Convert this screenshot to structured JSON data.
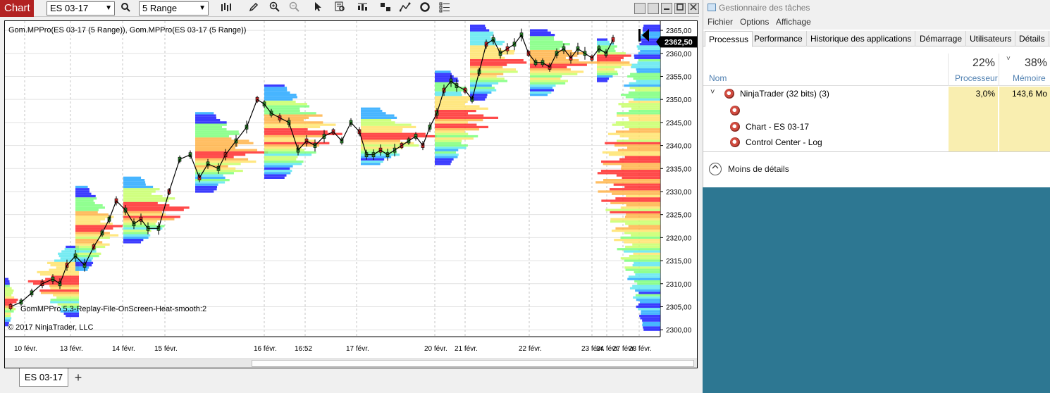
{
  "chart_window": {
    "badge": "Chart",
    "instrument": "ES 03-17",
    "bar_type": "5 Range",
    "indicator_label": "Gom.MPPro(ES 03-17 (5 Range)), Gom.MPPro(ES 03-17 (5 Range))",
    "template_label": "GomMPPro 5.3-Replay-File-OnScreen-Heat-smooth:2",
    "copyright": "© 2017 NinjaTrader, LLC",
    "tab_label": "ES 03-17",
    "add_tab": "+",
    "icons": [
      "search-icon",
      "bar-style-icon",
      "draw-pencil-icon",
      "zoom-in-icon",
      "zoom-out-icon",
      "pointer-icon",
      "data-box-icon",
      "bar-spacing-icon",
      "template-icon",
      "strategy-icon",
      "refresh-icon",
      "properties-icon"
    ]
  },
  "chart_data": {
    "type": "line",
    "instrument": "ES 03-17",
    "y_labels": [
      "2365,00",
      "2360,00",
      "2355,00",
      "2350,00",
      "2345,00",
      "2340,00",
      "2335,00",
      "2330,00",
      "2325,00",
      "2320,00",
      "2315,00",
      "2310,00",
      "2305,00",
      "2300,00"
    ],
    "y_values": [
      2365,
      2360,
      2355,
      2350,
      2345,
      2340,
      2335,
      2330,
      2325,
      2320,
      2315,
      2310,
      2305,
      2300
    ],
    "ylim": [
      2298.5,
      2367
    ],
    "last_price": "2362,50",
    "last_price_value": 2362.5,
    "x_labels": [
      "10 févr.",
      "13 févr.",
      "14 févr.",
      "15 févr.",
      "16 févr.",
      "16:52",
      "17 févr.",
      "20 févr.",
      "21 févr.",
      "22 févr.",
      "23 févr.",
      "24 févr.",
      "27 févr.",
      "28 févr."
    ],
    "series": [
      {
        "x": [
          0,
          15,
          30,
          45,
          60,
          70,
          80,
          92,
          105,
          118,
          130,
          140,
          150,
          163,
          175,
          185,
          195,
          210,
          225,
          240,
          255,
          268,
          280,
          295,
          305,
          320,
          335,
          350,
          360,
          370,
          382,
          395,
          408,
          420,
          432,
          445,
          458,
          470,
          483,
          495,
          505,
          515,
          525,
          535,
          545,
          555,
          565,
          575,
          585,
          595,
          605,
          615,
          625,
          633,
          645,
          655,
          665,
          675,
          685,
          695,
          705,
          715,
          725,
          735,
          745,
          755,
          765,
          775,
          785,
          795,
          805,
          815,
          825,
          835,
          845,
          855
        ],
        "close": [
          2305,
          2306,
          2308,
          2310,
          2311,
          2310,
          2314,
          2316,
          2314,
          2318,
          2321,
          2324,
          2328,
          2326,
          2323,
          2324,
          2322,
          2322,
          2330,
          2337,
          2338,
          2333,
          2336,
          2335,
          2338,
          2341,
          2344,
          2350,
          2349,
          2347,
          2346,
          2345,
          2339,
          2341,
          2340,
          2342,
          2343,
          2341,
          2345,
          2343,
          2338,
          2338,
          2339,
          2338,
          2339,
          2340,
          2341,
          2342,
          2340,
          2344,
          2347,
          2352,
          2354,
          2353,
          2352,
          2350,
          2356,
          2362,
          2363,
          2360,
          2361,
          2362,
          2364,
          2360,
          2358,
          2358,
          2357,
          2360,
          2361,
          2359,
          2361,
          2360,
          2359,
          2361,
          2360,
          2363
        ]
      }
    ],
    "grid": true,
    "legend": "none",
    "profile_color_scale": [
      "#1a1aff",
      "#27a8ff",
      "#5ee8f0",
      "#7dff7d",
      "#c8ff6a",
      "#ffe36b",
      "#ffb347",
      "#ff2a2a"
    ],
    "price_up_color": "#000000",
    "price_down_color": "#000000"
  },
  "task_manager": {
    "title": "Gestionnaire des tâches",
    "menu": [
      "Fichier",
      "Options",
      "Affichage"
    ],
    "tabs": [
      "Processus",
      "Performance",
      "Historique des applications",
      "Démarrage",
      "Utilisateurs",
      "Détails"
    ],
    "columns": {
      "name": "Nom",
      "cpu_pct": "22%",
      "cpu_label": "Processeur",
      "mem_pct": "38%",
      "mem_label": "Mémoire"
    },
    "process": {
      "name": "NinjaTrader (32 bits) (3)",
      "cpu": "3,0%",
      "mem": "143,6 Mo",
      "children": [
        "",
        "Chart - ES 03-17",
        "Control Center - Log"
      ]
    },
    "less_details": "Moins de détails"
  },
  "colors": {
    "chart_badge": "#b22222",
    "desktop": "#2d7792",
    "highlight_yellow": "#f9eeb0"
  }
}
